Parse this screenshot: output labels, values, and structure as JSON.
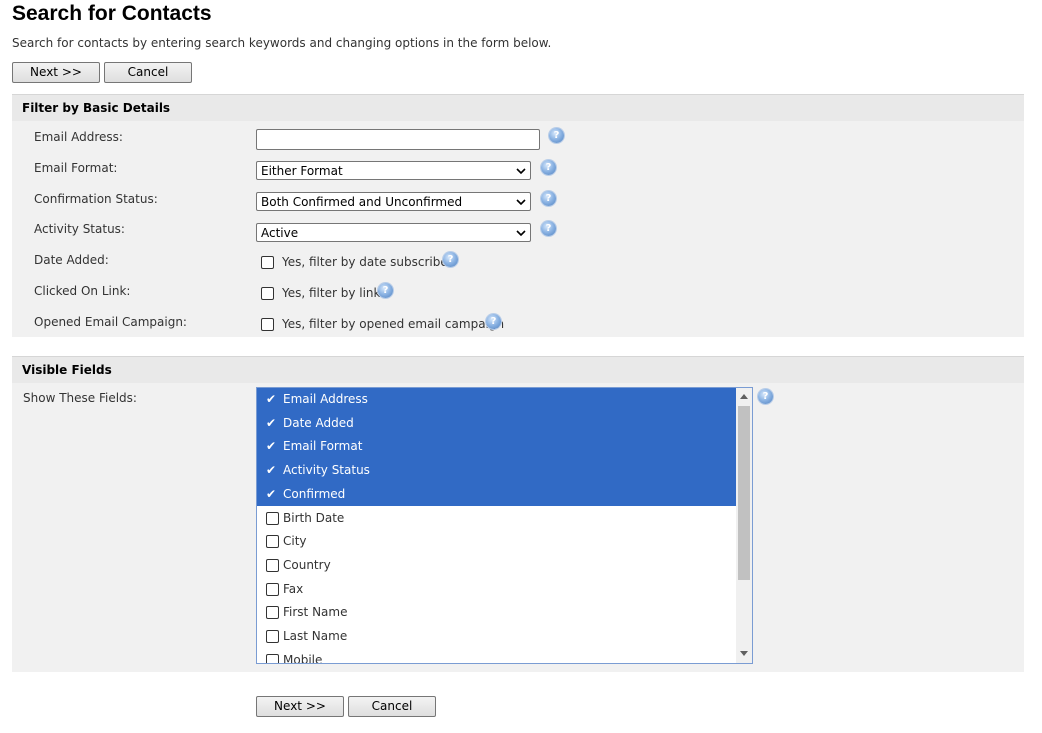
{
  "page": {
    "title": "Search for Contacts",
    "intro": "Search for contacts by entering search keywords and changing options in the form below."
  },
  "buttons": {
    "next": "Next >>",
    "cancel": "Cancel"
  },
  "filter_section": {
    "header": "Filter by Basic Details",
    "email_address": {
      "label": "Email Address:",
      "value": ""
    },
    "email_format": {
      "label": "Email Format:",
      "selected": "Either Format"
    },
    "confirmation_status": {
      "label": "Confirmation Status:",
      "selected": "Both Confirmed and Unconfirmed"
    },
    "activity_status": {
      "label": "Activity Status:",
      "selected": "Active"
    },
    "date_added": {
      "label": "Date Added:",
      "checkbox_label": "Yes, filter by date subscribed",
      "checked": false
    },
    "clicked_link": {
      "label": "Clicked On Link:",
      "checkbox_label": "Yes, filter by link",
      "checked": false
    },
    "opened_campaign": {
      "label": "Opened Email Campaign:",
      "checkbox_label": "Yes, filter by opened email campaign",
      "checked": false
    }
  },
  "visible_fields": {
    "header": "Visible Fields",
    "label": "Show These Fields:",
    "items": [
      {
        "label": "Email Address",
        "checked": true
      },
      {
        "label": "Date Added",
        "checked": true
      },
      {
        "label": "Email Format",
        "checked": true
      },
      {
        "label": "Activity Status",
        "checked": true
      },
      {
        "label": "Confirmed",
        "checked": true
      },
      {
        "label": "Birth Date",
        "checked": false
      },
      {
        "label": "City",
        "checked": false
      },
      {
        "label": "Country",
        "checked": false
      },
      {
        "label": "Fax",
        "checked": false
      },
      {
        "label": "First Name",
        "checked": false
      },
      {
        "label": "Last Name",
        "checked": false
      },
      {
        "label": "Mobile",
        "checked": false
      }
    ]
  },
  "colors": {
    "selected_row": "#316ac5",
    "section_background": "#f1f1f1",
    "section_header": "#e9e9e9",
    "help_icon": "#4c7fc0"
  },
  "icons": {
    "help": "help-question-icon",
    "dropdown": "chevron-down-icon",
    "selected_check": "checkmark-icon"
  }
}
